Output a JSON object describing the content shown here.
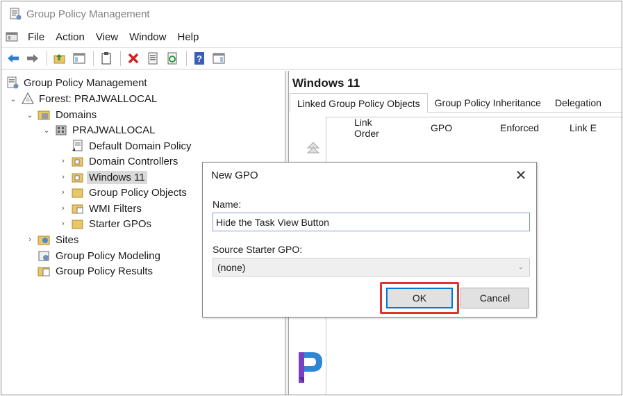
{
  "window": {
    "title": "Group Policy Management"
  },
  "menu": {
    "items": [
      "File",
      "Action",
      "View",
      "Window",
      "Help"
    ]
  },
  "tree": {
    "root": "Group Policy Management",
    "forest": "Forest: PRAJWALLOCAL",
    "domains": "Domains",
    "domain": "PRAJWALLOCAL",
    "default_policy": "Default Domain Policy",
    "domain_controllers": "Domain Controllers",
    "windows11": "Windows 11",
    "gpo_objects": "Group Policy Objects",
    "wmi_filters": "WMI Filters",
    "starter_gpos": "Starter GPOs",
    "sites": "Sites",
    "modeling": "Group Policy Modeling",
    "results": "Group Policy Results"
  },
  "right_pane": {
    "title": "Windows 11",
    "tabs": [
      "Linked Group Policy Objects",
      "Group Policy Inheritance",
      "Delegation"
    ],
    "columns": [
      "Link Order",
      "GPO",
      "Enforced",
      "Link E"
    ]
  },
  "dialog": {
    "title": "New GPO",
    "name_label": "Name:",
    "name_value": "Hide the Task View Button",
    "source_label": "Source Starter GPO:",
    "source_value": "(none)",
    "ok_label": "OK",
    "cancel_label": "Cancel"
  },
  "colors": {
    "highlight": "#e0332f",
    "accent": "#0078d7",
    "logo": "#7b3fc4"
  }
}
